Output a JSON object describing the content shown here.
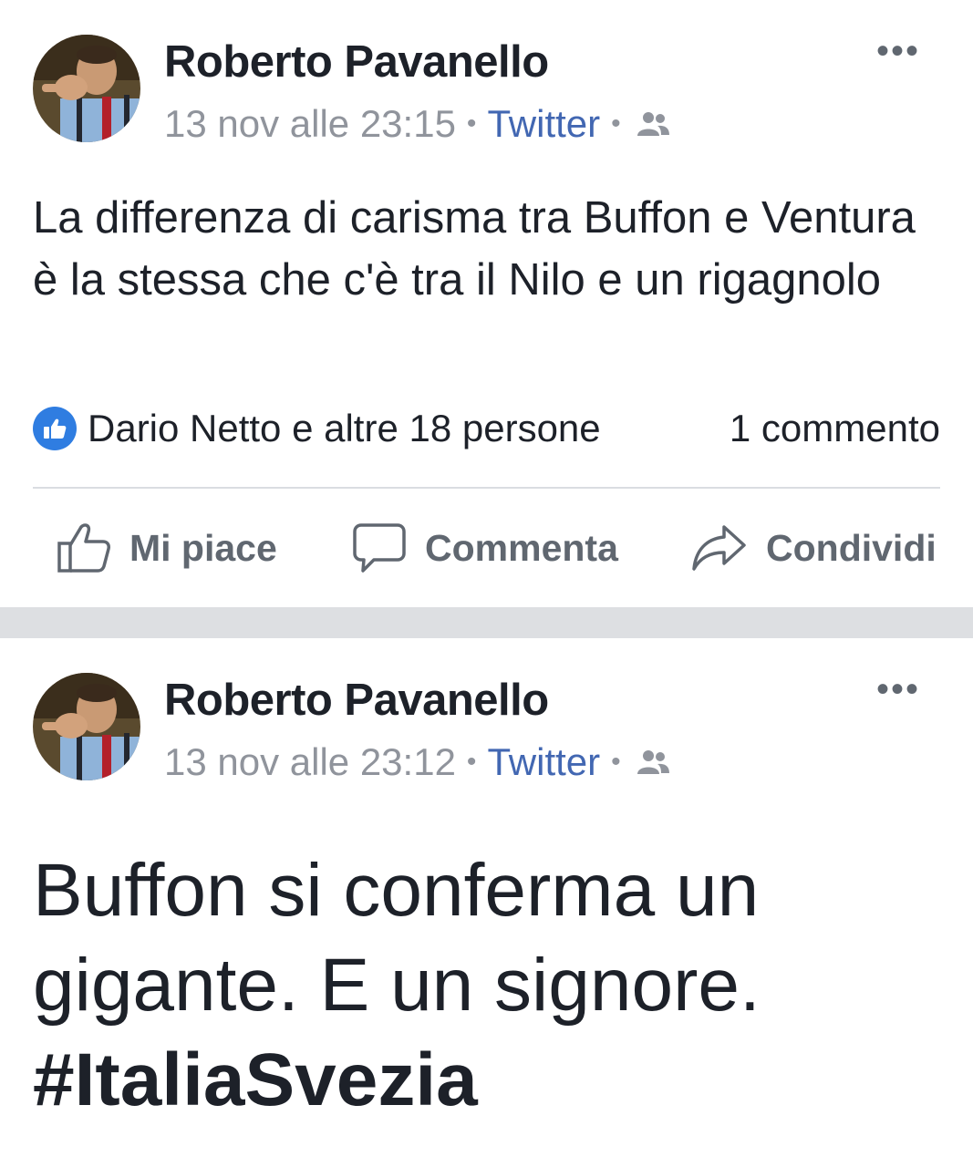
{
  "posts": [
    {
      "author": "Roberto Pavanello",
      "timestamp": "13 nov alle 23:15",
      "separator": "•",
      "source": "Twitter",
      "audience_icon": "friends-icon",
      "more_label": "•••",
      "text": "La differenza di carisma tra Buffon e Ventura è la stessa che c'è tra il Nilo e un rigagnolo",
      "reactions": {
        "icon": "like-badge-icon",
        "summary": "Dario Netto e altre 18 persone",
        "comments": "1 commento"
      },
      "actions": {
        "like_label": "Mi piace",
        "comment_label": "Commenta",
        "share_label": "Condividi"
      }
    },
    {
      "author": "Roberto Pavanello",
      "timestamp": "13 nov alle 23:12",
      "separator": "•",
      "source": "Twitter",
      "audience_icon": "friends-icon",
      "more_label": "•••",
      "text_line1": "Buffon si conferma un",
      "text_line2": "gigante. E un signore.",
      "hashtag": "#ItaliaSvezia"
    }
  ],
  "colors": {
    "link": "#4267b2",
    "meta": "#90949c",
    "text": "#1d2129",
    "like_badge": "#2f7de1",
    "action": "#606770",
    "feed_gap": "#dddfe2"
  }
}
